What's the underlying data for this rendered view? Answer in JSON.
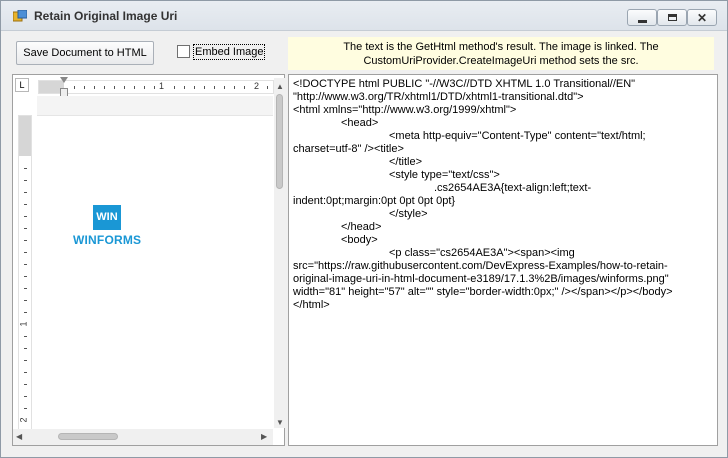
{
  "window": {
    "title": "Retain Original Image Uri",
    "min_glyph": "",
    "max_glyph": "",
    "close_glyph": "✕"
  },
  "toolbar": {
    "save_button_label": "Save Document to HTML",
    "embed_image_label": "Embed Image",
    "embed_image_checked": false,
    "info_line1": "The text is the GetHtml method's result. The image is linked. The",
    "info_line2": "CustomUriProvider.CreateImageUri method sets the src."
  },
  "editor": {
    "ruler_corner": "L",
    "h_ruler_numbers": [
      "1",
      "2"
    ],
    "v_ruler_numbers": [
      "1",
      "2"
    ],
    "logo_box_text": "WIN",
    "logo_text": "WINFORMS"
  },
  "html_output": {
    "lines": [
      {
        "indent": 0,
        "text": "<!DOCTYPE html PUBLIC \"-//W3C//DTD XHTML 1.0 Transitional//EN\""
      },
      {
        "indent": 0,
        "text": "\"http://www.w3.org/TR/xhtml1/DTD/xhtml1-transitional.dtd\">"
      },
      {
        "indent": 0,
        "text": "<html xmlns=\"http://www.w3.org/1999/xhtml\">"
      },
      {
        "indent": 1,
        "text": "<head>"
      },
      {
        "indent": 2,
        "text": "<meta http-equiv=\"Content-Type\" content=\"text/html;"
      },
      {
        "indent": 0,
        "text": "charset=utf-8\" /><title>"
      },
      {
        "indent": 2,
        "text": "</title>"
      },
      {
        "indent": 2,
        "text": "<style type=\"text/css\">"
      },
      {
        "indent": 3,
        "text": ".cs2654AE3A{text-align:left;text-"
      },
      {
        "indent": 0,
        "text": "indent:0pt;margin:0pt 0pt 0pt 0pt}"
      },
      {
        "indent": 2,
        "text": "</style>"
      },
      {
        "indent": 1,
        "text": "</head>"
      },
      {
        "indent": 1,
        "text": "<body>"
      },
      {
        "indent": 2,
        "text": "<p class=\"cs2654AE3A\"><span><img"
      },
      {
        "indent": 0,
        "text": "src=\"https://raw.githubusercontent.com/DevExpress-Examples/how-to-retain-"
      },
      {
        "indent": 0,
        "text": "original-image-uri-in-html-document-e3189/17.1.3%2B/images/winforms.png\""
      },
      {
        "indent": 0,
        "text": "width=\"81\" height=\"57\" alt=\"\" style=\"border-width:0px;\" /></span></p></body>"
      },
      {
        "indent": 0,
        "text": "</html>"
      }
    ]
  }
}
